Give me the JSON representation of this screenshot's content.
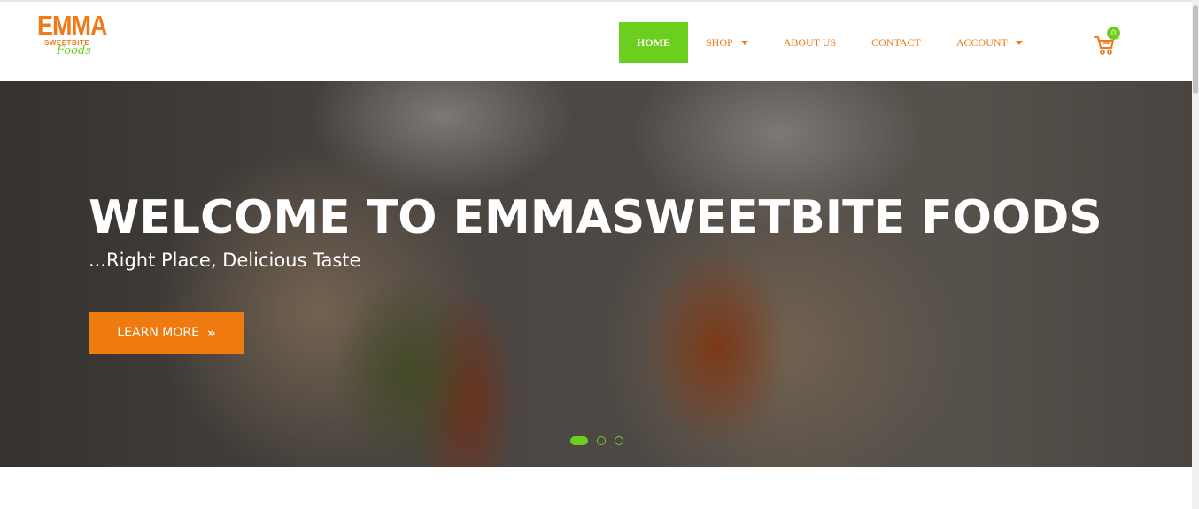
{
  "brand": {
    "logo_top": "EMMA",
    "logo_middle": "SWEETBITE",
    "logo_bottom": "Foods",
    "accent_orange": "#f07a18",
    "accent_green": "#6ccf1f"
  },
  "nav": {
    "items": [
      {
        "label": "HOME",
        "active": true
      },
      {
        "label": "SHOP",
        "dropdown": true
      },
      {
        "label": "ABOUT US"
      },
      {
        "label": "CONTACT"
      },
      {
        "label": "ACCOUNT",
        "dropdown": true
      }
    ],
    "cart_count": "0",
    "cart_icon": "cart-icon"
  },
  "hero": {
    "title": "WELCOME TO EMMASWEETBITE FOODS",
    "subtitle": "...Right Place, Delicious Taste",
    "button_label": "LEARN MORE",
    "button_icon": "double-chevron-right-icon",
    "slides": 3,
    "active_slide": 1
  }
}
